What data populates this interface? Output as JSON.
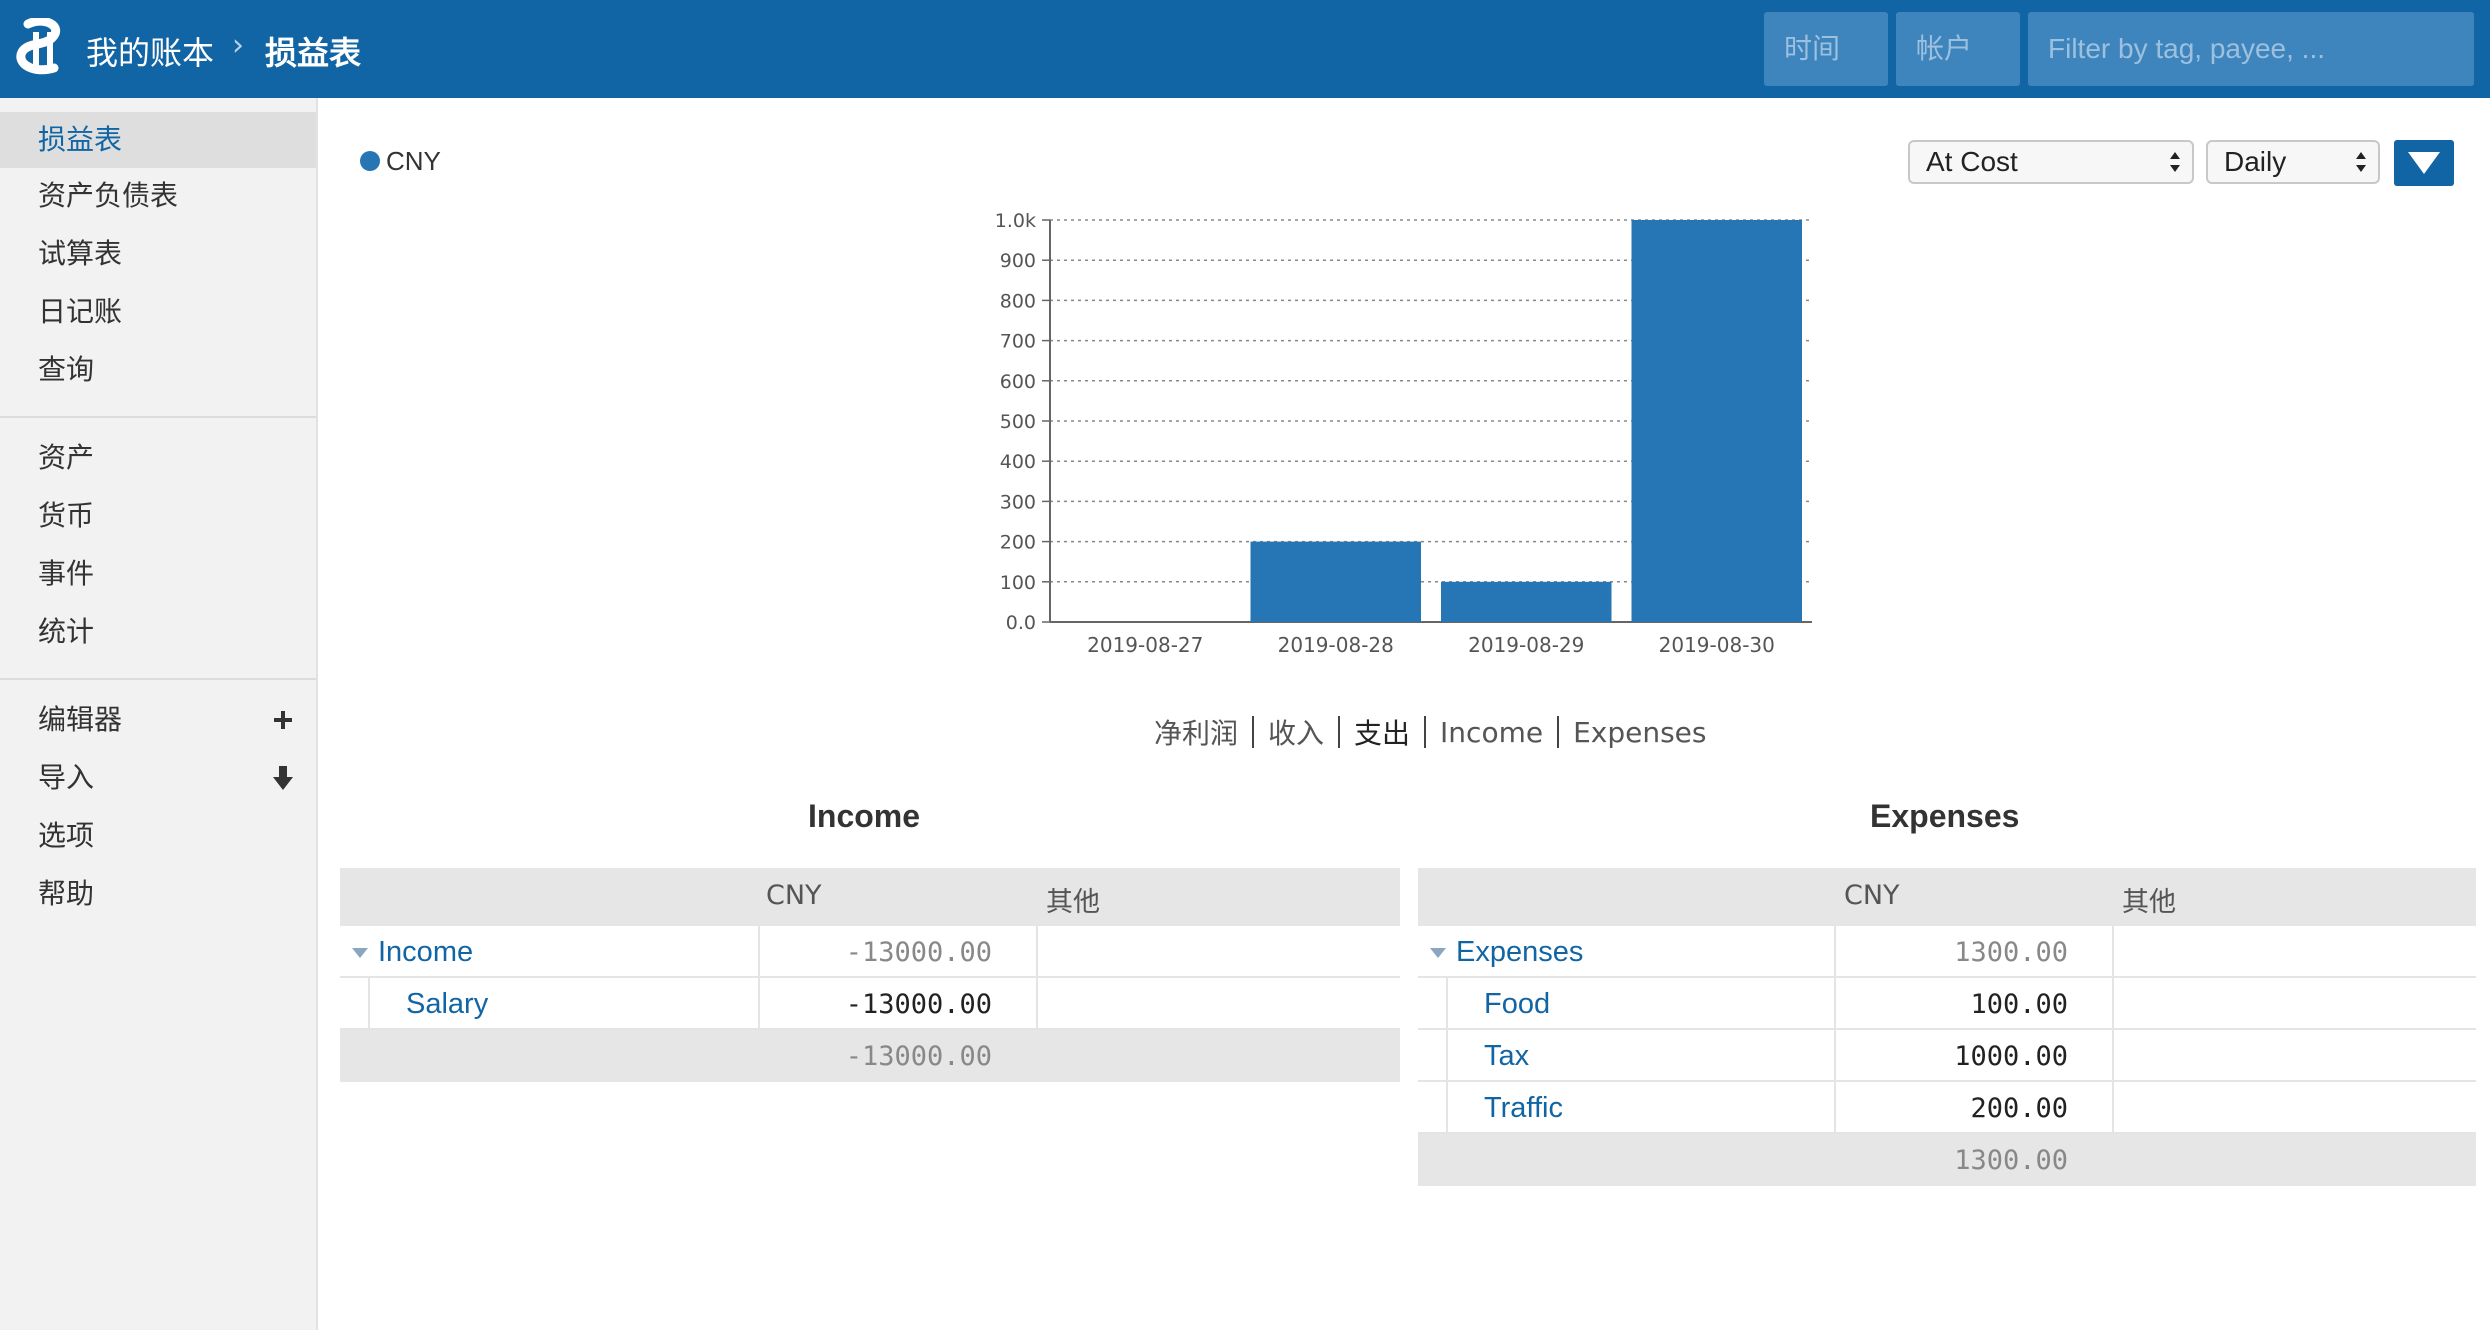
{
  "header": {
    "ledger_title": "我的账本",
    "separator": "›",
    "page_title": "损益表",
    "time_placeholder": "时间",
    "account_placeholder": "帐户",
    "filter_placeholder": "Filter by tag, payee, ..."
  },
  "sidebar": {
    "group1": [
      {
        "label": "损益表",
        "active": true
      },
      {
        "label": "资产负债表"
      },
      {
        "label": "试算表"
      },
      {
        "label": "日记账"
      },
      {
        "label": "查询"
      }
    ],
    "group2": [
      {
        "label": "资产"
      },
      {
        "label": "货币"
      },
      {
        "label": "事件"
      },
      {
        "label": "统计"
      }
    ],
    "group3": [
      {
        "label": "编辑器",
        "action_icon": "plus-icon"
      },
      {
        "label": "导入",
        "action_icon": "download-icon"
      },
      {
        "label": "选项"
      },
      {
        "label": "帮助"
      }
    ]
  },
  "controls": {
    "legend_label": "CNY",
    "conversion": "At Cost",
    "interval": "Daily"
  },
  "chart_data": {
    "type": "bar",
    "categories": [
      "2019-08-27",
      "2019-08-28",
      "2019-08-29",
      "2019-08-30"
    ],
    "series": [
      {
        "name": "CNY",
        "values": [
          0,
          200,
          100,
          1000
        ]
      }
    ],
    "ylim": [
      0,
      1000
    ],
    "yticks": [
      "0.0",
      "100",
      "200",
      "300",
      "400",
      "500",
      "600",
      "700",
      "800",
      "900",
      "1.0k"
    ],
    "grid": true,
    "color": "#2676b6"
  },
  "chart_modes": [
    "净利润",
    "收入",
    "支出",
    "Income",
    "Expenses"
  ],
  "income": {
    "title": "Income",
    "col_currency": "CNY",
    "col_other": "其他",
    "rows": [
      {
        "name": "Income",
        "value": "-13000.00"
      },
      {
        "name": "Salary",
        "value": "-13000.00"
      }
    ],
    "total": "-13000.00"
  },
  "expenses": {
    "title": "Expenses",
    "col_currency": "CNY",
    "col_other": "其他",
    "rows": [
      {
        "name": "Expenses",
        "value": "1300.00"
      },
      {
        "name": "Food",
        "value": "100.00"
      },
      {
        "name": "Tax",
        "value": "1000.00"
      },
      {
        "name": "Traffic",
        "value": "200.00"
      }
    ],
    "total": "1300.00"
  },
  "colors": {
    "header": "#1265a4",
    "bar": "#2676b6",
    "link": "#1265a4"
  }
}
